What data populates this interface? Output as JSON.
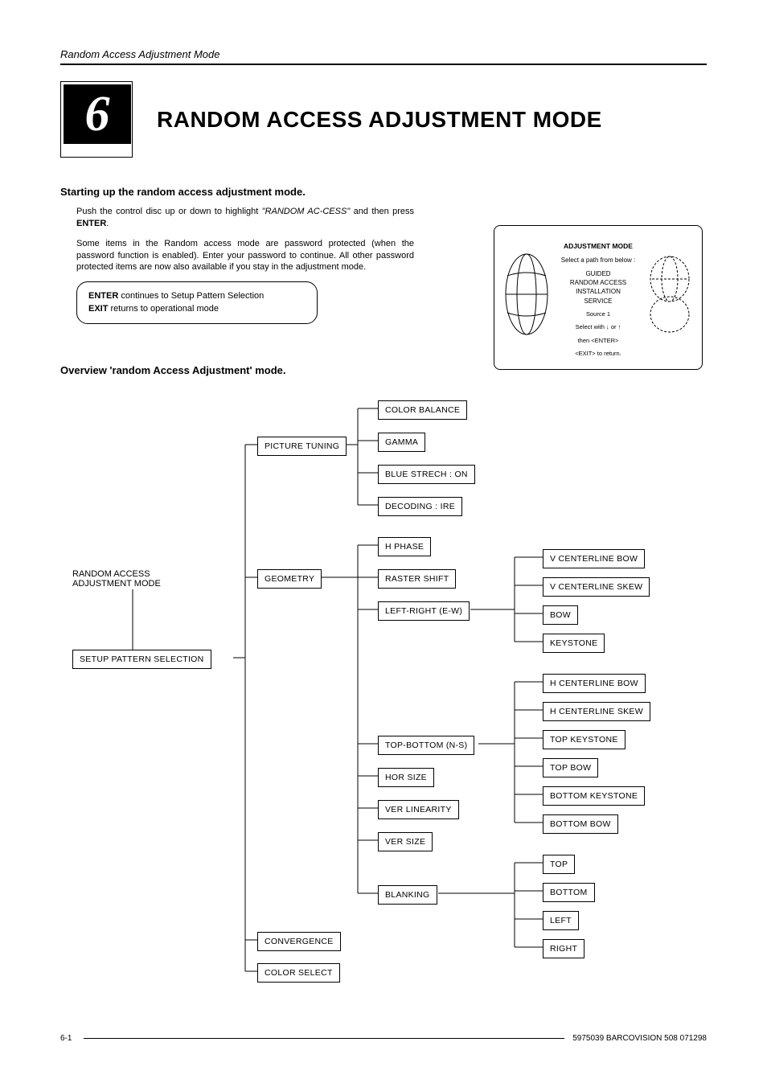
{
  "running_header": "Random Access Adjustment Mode",
  "chapter_number": "6",
  "chapter_title": "RANDOM ACCESS ADJUSTMENT MODE",
  "section1": {
    "title": "Starting up the random access adjustment mode.",
    "p1a": "Push the control disc up or down to highlight ",
    "p1b": "\"RANDOM AC-CESS\"",
    "p1c": " and then press ",
    "p1d": "ENTER",
    "p1e": ".",
    "p2": "Some items in the Random access mode are password protected (when the password function is enabled). Enter your password to continue. All other password protected items are now also available if you stay in the adjustment mode.",
    "note_l1a": "ENTER",
    "note_l1b": " continues to Setup Pattern Selection",
    "note_l2a": "EXIT",
    "note_l2b": " returns to operational mode"
  },
  "osd": {
    "title": "ADJUSTMENT MODE",
    "line1": "Select a path from below :",
    "opt1": "GUIDED",
    "opt2": "RANDOM ACCESS",
    "opt3": "INSTALLATION",
    "opt4": "SERVICE",
    "src": "Source 1",
    "hint1": "Select with ↓ or ↑",
    "hint2": "then <ENTER>",
    "hint3": "<EXIT> to return."
  },
  "section2_title": "Overview 'random Access Adjustment' mode.",
  "tree": {
    "root1": "RANDOM ACCESS",
    "root2": "ADJUSTMENT MODE",
    "setup": "SETUP PATTERN SELECTION",
    "picture_tuning": "PICTURE TUNING",
    "pt_children": [
      "COLOR BALANCE",
      "GAMMA",
      "BLUE STRECH : ON",
      "DECODING : IRE"
    ],
    "geometry": "GEOMETRY",
    "geo_children": [
      "H PHASE",
      "RASTER SHIFT",
      "LEFT-RIGHT (E-W)",
      "TOP-BOTTOM (N-S)",
      "HOR SIZE",
      "VER LINEARITY",
      "VER SIZE",
      "BLANKING"
    ],
    "lr_children": [
      "V CENTERLINE BOW",
      "V CENTERLINE SKEW",
      "BOW",
      "KEYSTONE"
    ],
    "tb_children": [
      "H CENTERLINE BOW",
      "H CENTERLINE SKEW",
      "TOP KEYSTONE",
      "TOP BOW",
      "BOTTOM KEYSTONE",
      "BOTTOM BOW"
    ],
    "blanking_children": [
      "TOP",
      "BOTTOM",
      "LEFT",
      "RIGHT"
    ],
    "convergence": "CONVERGENCE",
    "colorselect": "COLOR SELECT"
  },
  "footer": {
    "page_no": "6-1",
    "doc_id": "5975039 BARCOVISION 508 071298"
  }
}
